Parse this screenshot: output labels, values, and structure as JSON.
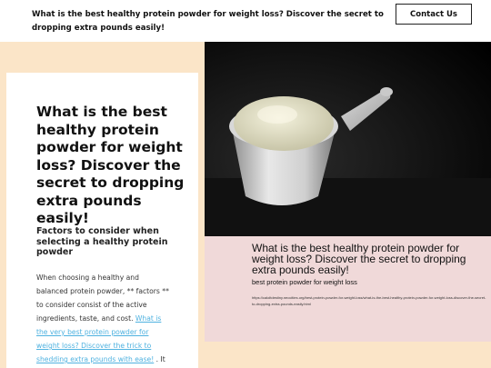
{
  "header": {
    "title": "What is the best healthy protein powder for weight loss? Discover the secret to dropping extra pounds easily!",
    "contact_label": "Contact Us"
  },
  "card": {
    "heading": "What is the best healthy protein powder for weight loss? Discover the secret to dropping extra pounds easily!",
    "subheading": "Factors to consider when selecting a healthy protein powder",
    "body_intro": "When choosing a healthy and balanced protein powder, ** factors ** to consider consist of the active ingredients, taste, and cost. ",
    "body_link": "What is the very best protein powder for weight loss? Discover the trick to shedding extra pounds with ease!",
    "body_outro": " . It is essential to pick a powder that is"
  },
  "caption": {
    "title": "What is the best healthy protein powder for weight loss? Discover the secret to dropping extra pounds easily!",
    "subtitle": "best protein powder for weight loss",
    "url": "https://caloltdestiny.neocities.org/best-protein-powder-for-weight-loss/what-is-the-best-healthy-protein-powder-for-weight-loss-discover-the-secret-to-dropping-extra-pounds-easily.html"
  },
  "image": {
    "alt": "scoop-of-protein-powder-photo"
  }
}
